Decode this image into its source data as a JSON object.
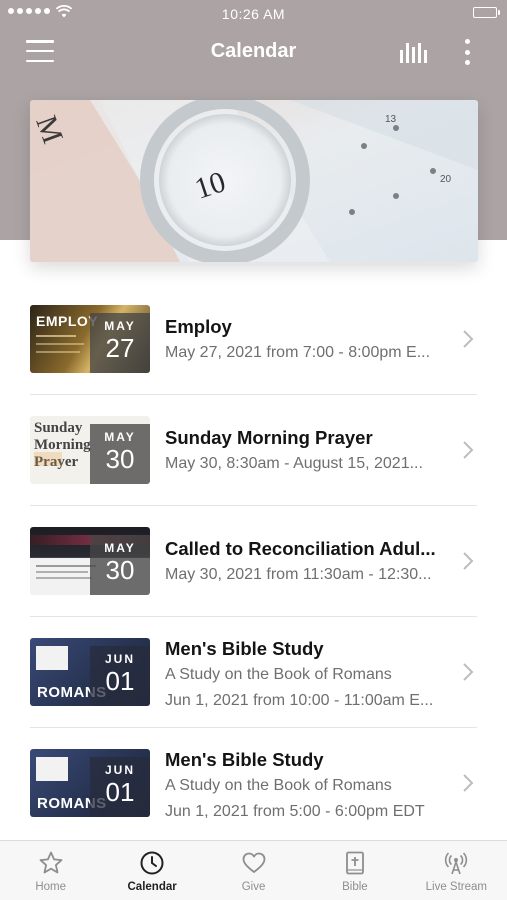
{
  "status_bar": {
    "time": "10:26 AM"
  },
  "header": {
    "title": "Calendar"
  },
  "icons": {
    "menu": "hamburger-menu-icon",
    "stats": "bar-chart-icon",
    "more": "vertical-ellipsis-icon"
  },
  "hero": {
    "calendar_numbers": [
      "10",
      "13",
      "20"
    ]
  },
  "events": [
    {
      "title": "Employ",
      "subtitle": "May 27, 2021 from 7:00 - 8:00pm E...",
      "description": "",
      "month": "MAY",
      "day": "27",
      "thumb_text": "EMPLOY"
    },
    {
      "title": "Sunday Morning Prayer",
      "subtitle": "May 30, 8:30am - August 15, 2021...",
      "description": "",
      "month": "MAY",
      "day": "30",
      "thumb_text": "Sunday Morning Prayer"
    },
    {
      "title": "Called to Reconciliation Adul...",
      "subtitle": "May 30, 2021 from 11:30am - 12:30...",
      "description": "",
      "month": "MAY",
      "day": "30",
      "thumb_text": ""
    },
    {
      "title": "Men's Bible Study",
      "subtitle": "Jun 1, 2021 from 10:00 - 11:00am E...",
      "description": "A Study on the Book of Romans",
      "month": "JUN",
      "day": "01",
      "thumb_text": "ROMANS"
    },
    {
      "title": "Men's Bible Study",
      "subtitle": "Jun 1, 2021 from 5:00 - 6:00pm EDT",
      "description": "A Study on the Book of Romans",
      "month": "JUN",
      "day": "01",
      "thumb_text": "ROMANS"
    }
  ],
  "tabs": [
    {
      "label": "Home",
      "icon": "star-icon",
      "active": false
    },
    {
      "label": "Calendar",
      "icon": "clock-icon",
      "active": true
    },
    {
      "label": "Give",
      "icon": "heart-icon",
      "active": false
    },
    {
      "label": "Bible",
      "icon": "bible-icon",
      "active": false
    },
    {
      "label": "Live Stream",
      "icon": "broadcast-icon",
      "active": false
    }
  ],
  "colors": {
    "header_bg": "#aca4a4",
    "active_tab": "#222222",
    "inactive_tab": "#8e8e8e"
  }
}
